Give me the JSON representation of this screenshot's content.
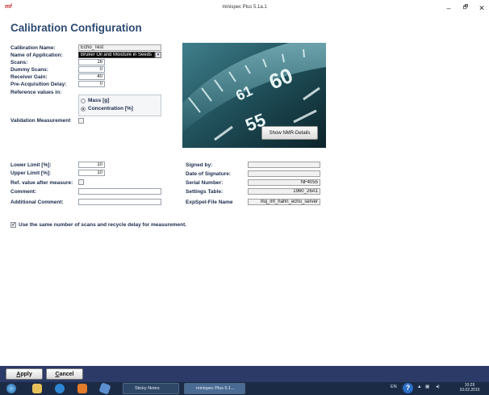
{
  "window": {
    "logo": "mf",
    "title": "minispec Plus 5.1a.1",
    "minimize": "–",
    "maximize": "🗗",
    "close": "✕"
  },
  "page": {
    "heading": "Calibration Configuration"
  },
  "form": {
    "calibration_name": {
      "label": "Calibration Name:",
      "value": "Echo_Test"
    },
    "application": {
      "label": "Name of Application:",
      "value": "Bruker Oil and Moisture in Seeds"
    },
    "scans": {
      "label": "Scans:",
      "value": "16"
    },
    "dummy_scans": {
      "label": "Dummy Scans:",
      "value": "0"
    },
    "receiver_gain": {
      "label": "Receiver Gain:",
      "value": "40"
    },
    "pre_acq_delay": {
      "label": "Pre-Acquisition Delay:",
      "value": "0"
    },
    "reference": {
      "label": "Reference values in:",
      "option_mass": "Mass [g]",
      "option_concentration": "Concentration [%]",
      "selected": "Concentration [%]"
    },
    "validation": {
      "label": "Validation Measurement",
      "checked": false
    },
    "lower_limit": {
      "label": "Lower Limit [%]:",
      "value": "10"
    },
    "upper_limit": {
      "label": "Upper Limit [%]:",
      "value": "10"
    },
    "ref_after": {
      "label": "Ref. value after measure:",
      "checked": false
    },
    "comment": {
      "label": "Comment:",
      "value": ""
    },
    "additional_comment": {
      "label": "Additional Comment:",
      "value": ""
    },
    "same_scans": {
      "label": "Use the same number of scans and recycle delay for measurement.",
      "checked": true
    }
  },
  "info": {
    "signed_by": {
      "label": "Signed by:",
      "value": ""
    },
    "date_of_signature": {
      "label": "Date of Signature:",
      "value": ""
    },
    "serial_number": {
      "label": "Serial Number:",
      "value": "NF4055"
    },
    "settings_table": {
      "label": "Settings Table:",
      "value": "1960_26A1"
    },
    "expspel_file": {
      "label": "ExpSpel-File Name",
      "value": "mq_mf_hahn_echo_server"
    }
  },
  "image": {
    "digits_big": "60",
    "digits_mid1": "55",
    "digits_mid2": "61",
    "button": "Show NMR-Details"
  },
  "buttons": {
    "apply_first": "A",
    "apply_rest": "pply",
    "cancel_first": "C",
    "cancel_rest": "ancel"
  },
  "taskbar": {
    "task1": "Sticky Notes",
    "task2": "minispec Plus 5.1...",
    "lang": "EN",
    "time": "10:29",
    "date": "10.02.2015"
  },
  "colors": {
    "heading": "#2e4a73",
    "toolbar": "#2b3a66",
    "taskbar": "#1c2b45",
    "logo": "#c0282e"
  }
}
